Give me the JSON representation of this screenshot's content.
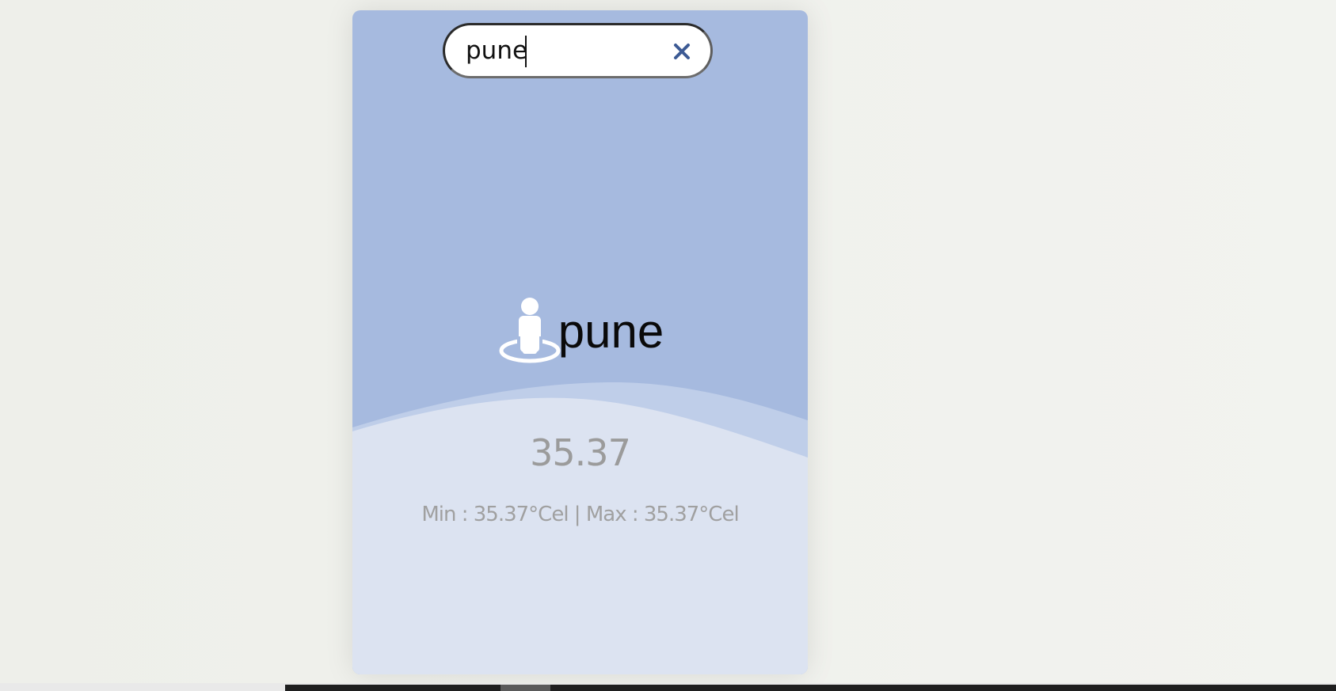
{
  "search": {
    "value": "pune",
    "clear_icon": "close-icon"
  },
  "location": {
    "icon": "person-location-icon",
    "city": "pune"
  },
  "weather": {
    "temperature": "35.37",
    "minmax": "Min : 35.37°Cel | Max : 35.37°Cel"
  },
  "colors": {
    "card_top": "#a6badf",
    "card_bottom": "#dce3f1",
    "clear_icon": "#3c5a94",
    "text_muted": "#9b9b9b"
  }
}
